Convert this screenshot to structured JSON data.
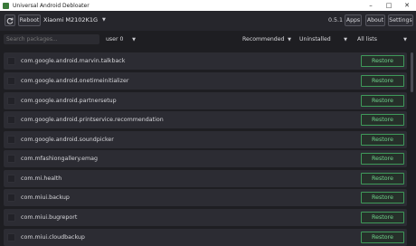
{
  "window": {
    "title": "Universal Android Debloater"
  },
  "toolbar": {
    "refresh_icon": "refresh-icon",
    "reboot_label": "Reboot",
    "device_label": "Xiaomi M2102K1G",
    "version": "0.5.1",
    "apps_label": "Apps",
    "about_label": "About",
    "settings_label": "Settings"
  },
  "filters": {
    "search_placeholder": "Search packages...",
    "user_select": "user 0",
    "recommendation_select": "Recommended",
    "state_select": "Uninstalled",
    "list_select": "All lists"
  },
  "packages": [
    {
      "name": "com.google.android.marvin.talkback",
      "action": "Restore"
    },
    {
      "name": "com.google.android.onetimeinitializer",
      "action": "Restore"
    },
    {
      "name": "com.google.android.partnersetup",
      "action": "Restore"
    },
    {
      "name": "com.google.android.printservice.recommendation",
      "action": "Restore"
    },
    {
      "name": "com.google.android.soundpicker",
      "action": "Restore"
    },
    {
      "name": "com.mfashiongallery.emag",
      "action": "Restore"
    },
    {
      "name": "com.mi.health",
      "action": "Restore"
    },
    {
      "name": "com.miui.backup",
      "action": "Restore"
    },
    {
      "name": "com.miui.bugreport",
      "action": "Restore"
    },
    {
      "name": "com.miui.cloudbackup",
      "action": "Restore"
    }
  ],
  "colors": {
    "accent": "#6fd08a",
    "background": "#1e1e22",
    "row": "#2c2c33"
  }
}
